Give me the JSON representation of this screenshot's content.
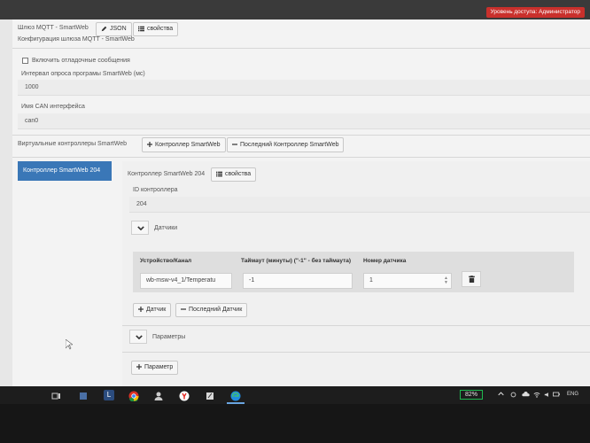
{
  "header": {
    "access_badge": "Уровень доступа: Администратор",
    "gateway_title": "Шлюз MQTT - SmartWeb",
    "json_button": "JSON",
    "properties_button": "свойства",
    "config_title": "Конфигурация шлюза MQTT - SmartWeb"
  },
  "settings": {
    "debug_label": "Включить отладочные сообщения",
    "poll_label": "Интервал опроса програмы SmartWeb (мс)",
    "poll_value": "1000",
    "can_label": "Имя CAN интерфейса",
    "can_value": "can0"
  },
  "controllers": {
    "section_label": "Виртуальные контроллеры SmartWeb",
    "add_button": "Контроллер SmartWeb",
    "remove_last_button": "Последний Контроллер SmartWeb",
    "active_item": "Контроллер SmartWeb 204"
  },
  "controller": {
    "title": "Контроллер SmartWeb 204",
    "properties_button": "свойства",
    "id_label": "ID контроллера",
    "id_value": "204",
    "sensors_label": "Датчики",
    "columns": [
      "Устройство/Канал",
      "Таймаут (минуты) (\"-1\" - без таймаута)",
      "Номер датчика"
    ],
    "rows": [
      {
        "device": "wb-msw-v4_1/Temperatu",
        "timeout": "-1",
        "sensor_number": "1"
      }
    ],
    "add_sensor_button": "Датчик",
    "remove_sensor_button": "Последний Датчик",
    "params_label": "Параметры",
    "add_param_button": "Параметр"
  },
  "taskbar": {
    "letter_icon": "L",
    "battery": "82%",
    "lang": "ENG"
  },
  "colors": {
    "accent": "#3a77b7",
    "badge": "#c9302c",
    "battery": "#1fb84f"
  }
}
